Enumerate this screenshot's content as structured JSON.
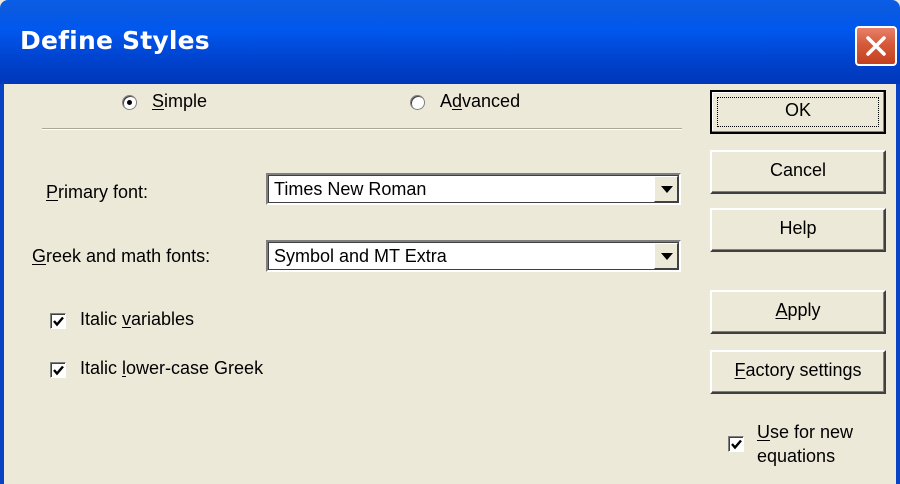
{
  "window": {
    "title": "Define Styles"
  },
  "mode": {
    "simple_label": "Simple",
    "advanced_label": "Advanced",
    "selected": "Simple"
  },
  "fonts": {
    "primary_label": "Primary font:",
    "primary_value": "Times New Roman",
    "greek_label": "Greek and math fonts:",
    "greek_value": "Symbol and MT Extra"
  },
  "options": {
    "italic_variables_label": "Italic variables",
    "italic_variables_checked": true,
    "italic_greek_label": "Italic lower-case Greek",
    "italic_greek_checked": true
  },
  "buttons": {
    "ok": "OK",
    "cancel": "Cancel",
    "help": "Help",
    "apply": "Apply",
    "factory": "Factory settings"
  },
  "use_new": {
    "label_line1": "Use for new",
    "label_line2": "equations",
    "checked": true
  },
  "colors": {
    "titlebar": "#0054e3",
    "close_button": "#d55a3a",
    "dialog_background": "#ece9d8"
  },
  "icons": {
    "close": "close-icon",
    "dropdown": "chevron-down-icon",
    "check": "checkmark-icon"
  }
}
